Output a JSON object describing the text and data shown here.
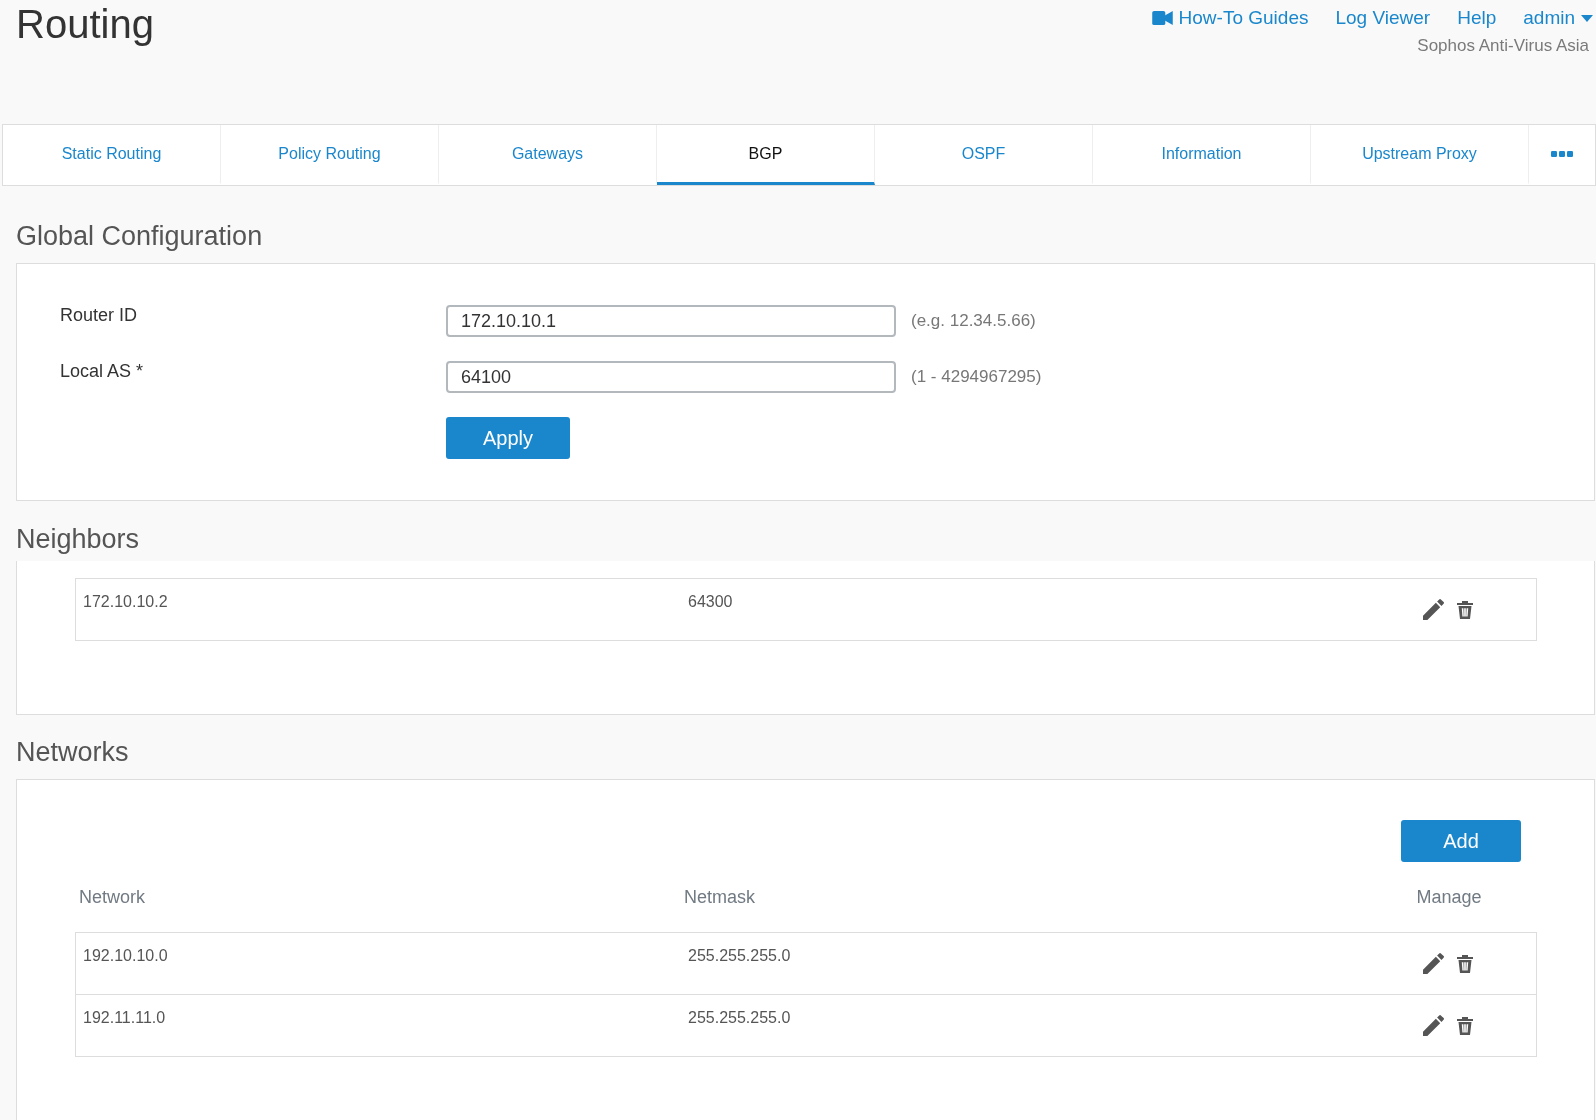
{
  "header": {
    "title": "Routing",
    "links": [
      {
        "label": "How-To Guides",
        "kind": "video"
      },
      {
        "label": "Log Viewer",
        "kind": "plain"
      },
      {
        "label": "Help",
        "kind": "plain"
      },
      {
        "label": "admin",
        "kind": "menu"
      }
    ],
    "subtitle": "Sophos Anti-Virus Asia"
  },
  "tabs": [
    {
      "kind": "text",
      "label": "Static Routing",
      "selected": false
    },
    {
      "kind": "text",
      "label": "Policy Routing",
      "selected": false
    },
    {
      "kind": "text",
      "label": "Gateways",
      "selected": false
    },
    {
      "kind": "text",
      "label": "BGP",
      "selected": true
    },
    {
      "kind": "text",
      "label": "OSPF",
      "selected": false
    },
    {
      "kind": "text",
      "label": "Information",
      "selected": false
    },
    {
      "kind": "text",
      "label": "Upstream Proxy",
      "selected": false
    },
    {
      "kind": "more",
      "selected": false
    }
  ],
  "global_configuration": {
    "heading": "Global Configuration",
    "fields": [
      {
        "label": "Router ID",
        "value": "172.10.10.1",
        "hint": "(e.g. 12.34.5.66)"
      },
      {
        "label": "Local AS *",
        "value": "64100",
        "hint": "(1 - 4294967295)"
      }
    ],
    "apply_button": "Apply"
  },
  "neighbors": {
    "heading": "Neighbors",
    "rows": [
      {
        "cells": [
          "172.10.10.2",
          "64300"
        ]
      }
    ]
  },
  "networks": {
    "heading": "Networks",
    "add_button": "Add",
    "columns": [
      "Network",
      "Netmask",
      "Manage"
    ],
    "rows": [
      {
        "cells": [
          "192.10.10.0",
          "255.255.255.0"
        ]
      },
      {
        "cells": [
          "192.11.11.0",
          "255.255.255.0"
        ]
      }
    ]
  }
}
